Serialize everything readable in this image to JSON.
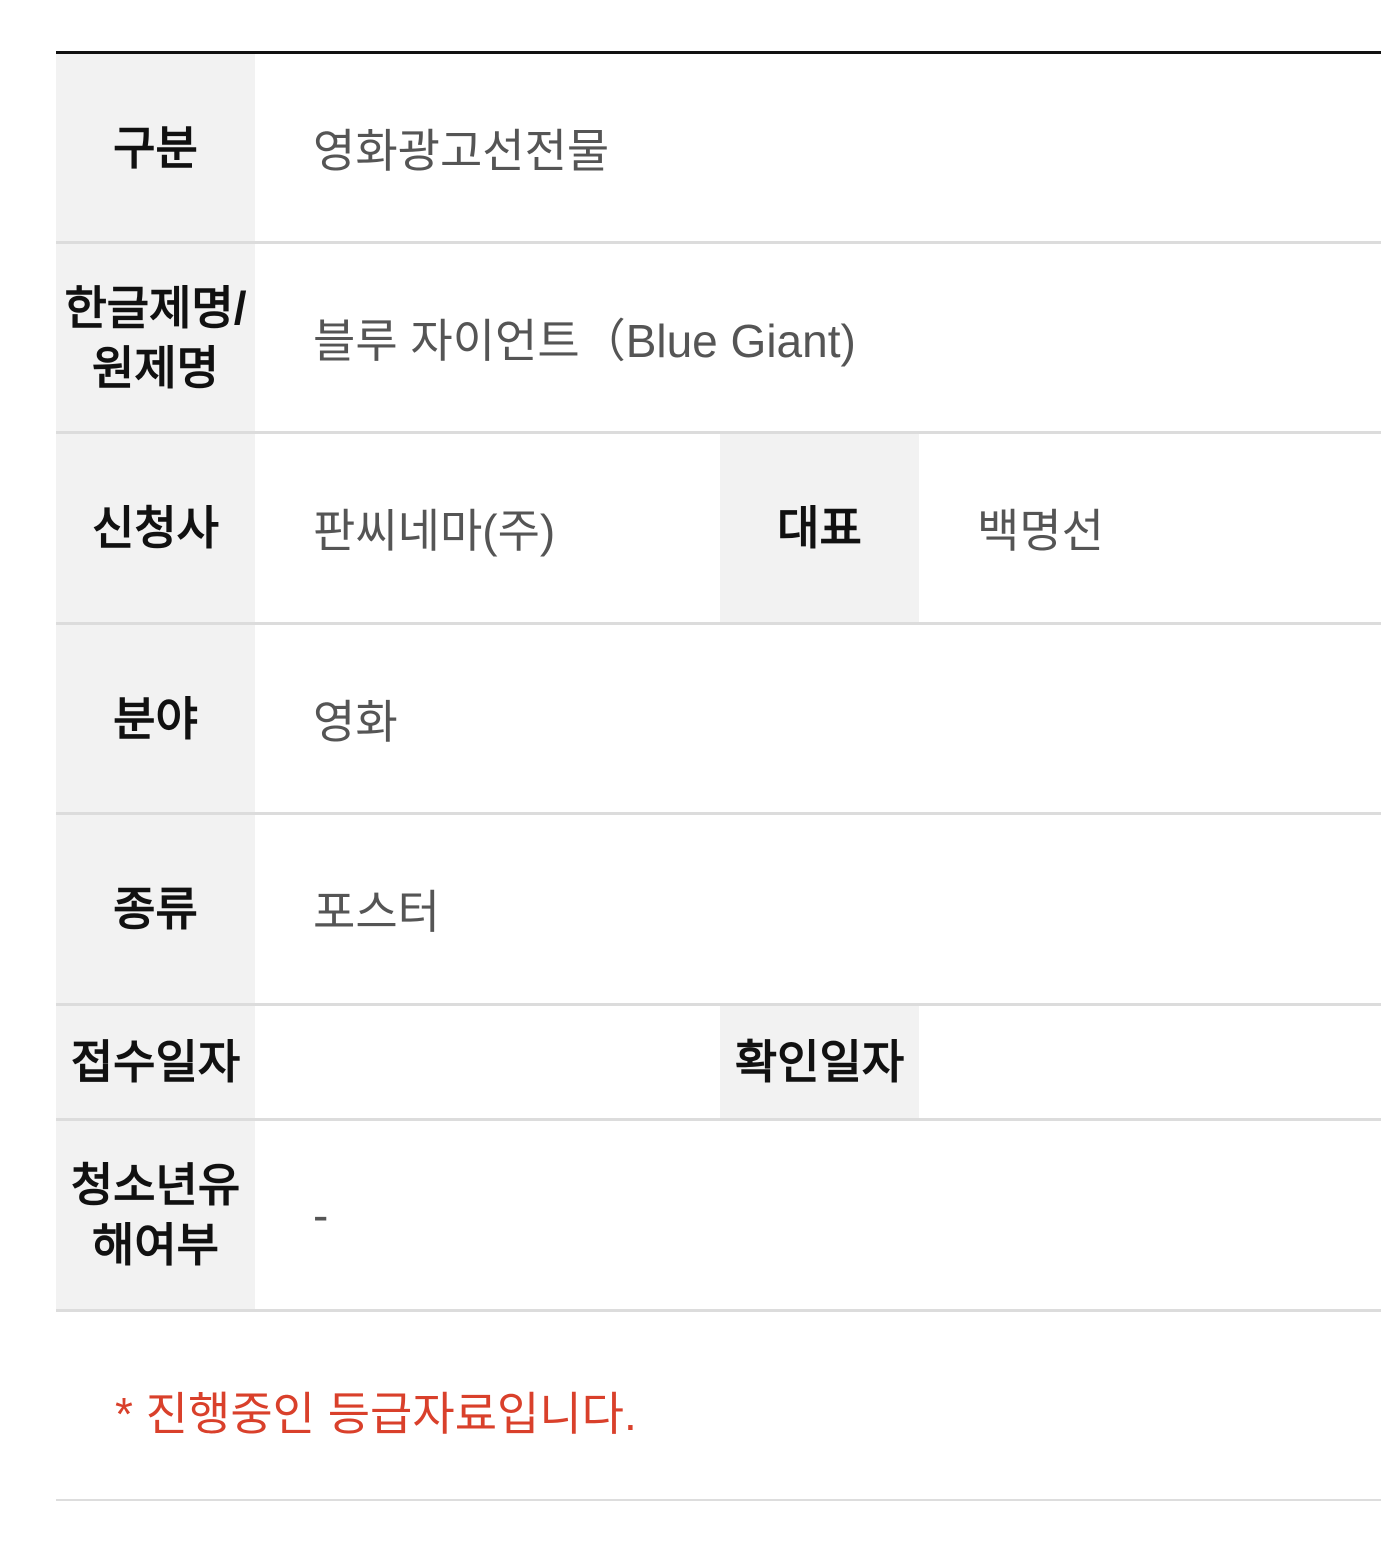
{
  "rows": [
    {
      "label": "구분",
      "value": "영화광고선전물"
    },
    {
      "label": "한글제명/원제명",
      "value": "블루 자이언트（Blue Giant)"
    },
    {
      "label": "신청사",
      "value": "판씨네마(주)",
      "label2": "대표",
      "value2": "백명선"
    },
    {
      "label": "분야",
      "value": "영화"
    },
    {
      "label": "종류",
      "value": "포스터"
    },
    {
      "label": "접수일자",
      "value": "",
      "label2": "확인일자",
      "value2": ""
    },
    {
      "label": "청소년유해여부",
      "value": "-"
    }
  ],
  "note": "* 진행중인 등급자료입니다.",
  "colors": {
    "label_bg": "#f2f2f2",
    "note": "#d9402b",
    "border": "#dcdcdc"
  }
}
